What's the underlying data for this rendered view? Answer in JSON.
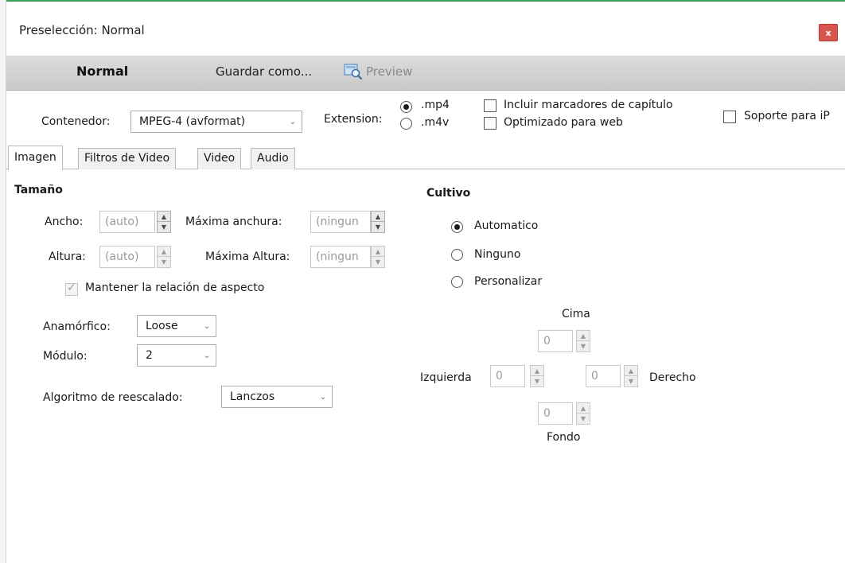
{
  "window": {
    "title": "Preselección: Normal",
    "close_glyph": "x"
  },
  "toolbar": {
    "preset_name": "Normal",
    "save_as": "Guardar como...",
    "preview": "Preview",
    "preview_icon": "preview-magnifier-icon"
  },
  "container_row": {
    "container_label": "Contenedor:",
    "container_value": "MPEG-4 (avformat)",
    "extension_label": "Extension:",
    "ext_mp4": ".mp4",
    "ext_m4v": ".m4v",
    "chapter_markers": "Incluir marcadores de capítulo",
    "web_optimized": "Optimizado para web",
    "ipod_support": "Soporte para iP"
  },
  "tabs": [
    {
      "label": "Imagen",
      "active": true
    },
    {
      "label": "Filtros de Video",
      "active": false
    },
    {
      "label": "Video",
      "active": false
    },
    {
      "label": "Audio",
      "active": false
    }
  ],
  "size": {
    "title": "Tamaño",
    "width_label": "Ancho:",
    "width_value": "(auto)",
    "max_width_label": "Máxima anchura:",
    "max_width_value": "(ningun",
    "height_label": "Altura:",
    "height_value": "(auto)",
    "max_height_label": "Máxima Altura:",
    "max_height_value": "(ningun",
    "keep_aspect": "Mantener la relación de aspecto",
    "anamorphic_label": "Anamórfico:",
    "anamorphic_value": "Loose",
    "modulus_label": "Módulo:",
    "modulus_value": "2",
    "scaler_label": "Algoritmo de reescalado:",
    "scaler_value": "Lanczos"
  },
  "crop": {
    "title": "Cultivo",
    "auto": "Automatico",
    "none": "Ninguno",
    "custom": "Personalizar",
    "top_label": "Cima",
    "top_value": "0",
    "left_label": "Izquierda",
    "left_value": "0",
    "right_label": "Derecho",
    "right_value": "0",
    "bottom_label": "Fondo",
    "bottom_value": "0"
  },
  "colors": {
    "accent_line": "#3aa35a",
    "close_button": "#d9534f"
  }
}
